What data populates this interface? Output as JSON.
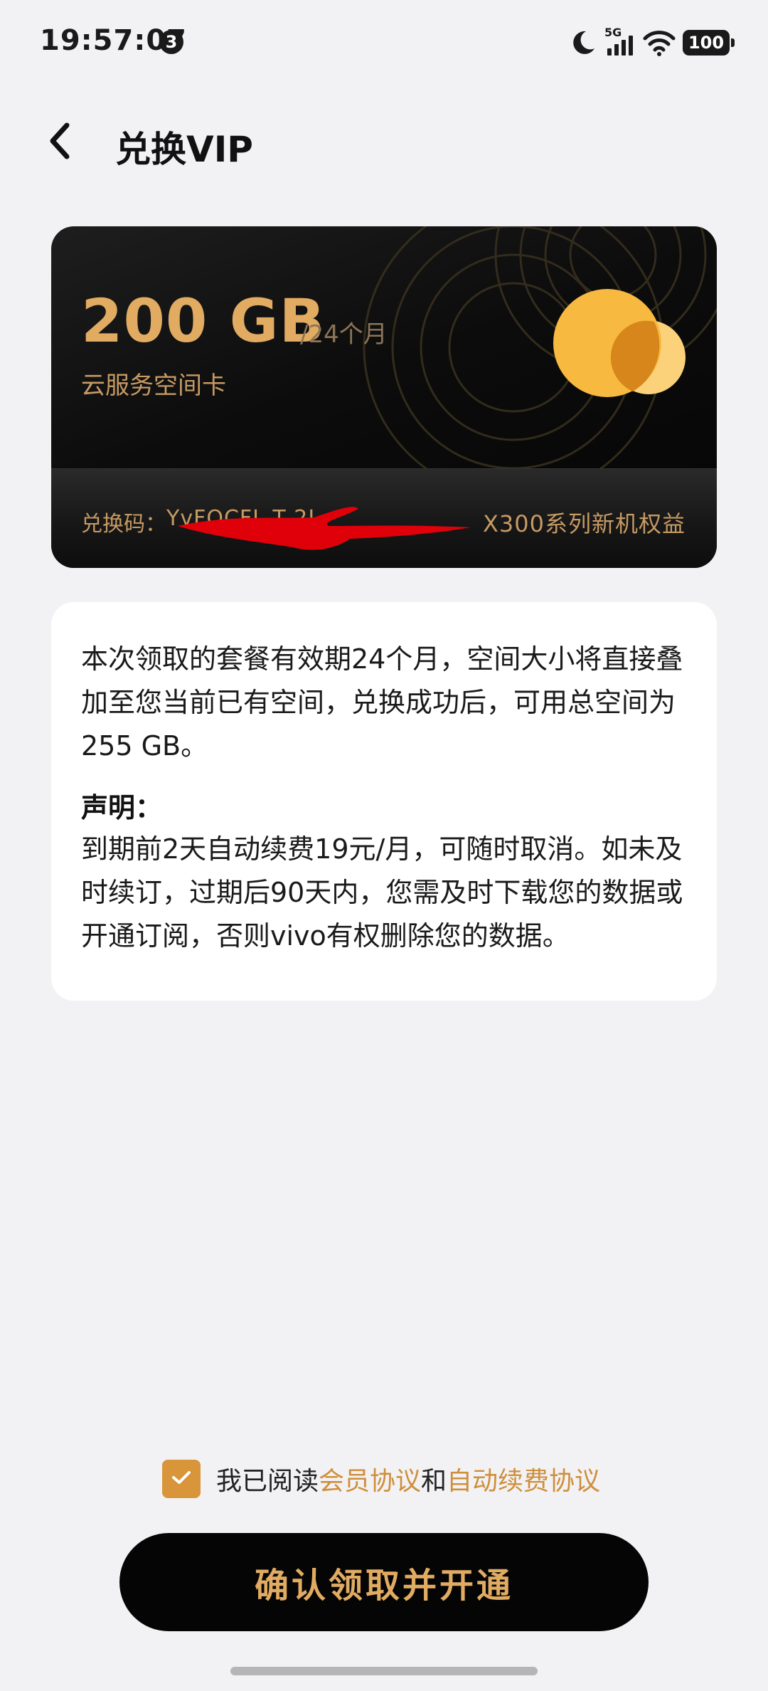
{
  "status_bar": {
    "time": "19:57:07",
    "notification_count": "3",
    "network": "5G",
    "battery": "100"
  },
  "header": {
    "title": "兑换VIP"
  },
  "card": {
    "amount": "200 GB",
    "period": "/24个月",
    "subtitle": "云服务空间卡",
    "code_label": "兑换码：",
    "code_value": "YvFOCFL T  2L",
    "benefit_tag": "X300系列新机权益",
    "accent_color": "#e1ab62"
  },
  "info": {
    "description": "本次领取的套餐有效期24个月，空间大小将直接叠加至您当前已有空间，兑换成功后，可用总空间为255 GB。",
    "declaration_title": "声明：",
    "declaration_text": "到期前2天自动续费19元/月，可随时取消。如未及时续订，过期后90天内，您需及时下载您的数据或开通订阅，否则vivo有权删除您的数据。"
  },
  "agreement": {
    "checked": true,
    "prefix": "我已阅读 ",
    "member_agreement": "会员协议",
    "and": "和",
    "auto_renew_agreement": "自动续费协议",
    "link_color": "#cf8f3b"
  },
  "confirm_button": {
    "label": "确认领取并开通"
  },
  "icons": {
    "back": "chevron-left-icon",
    "moon": "moon-icon",
    "signal": "signal-icon",
    "wifi": "wifi-icon",
    "cloud": "cloud-icon",
    "check": "check-icon"
  }
}
